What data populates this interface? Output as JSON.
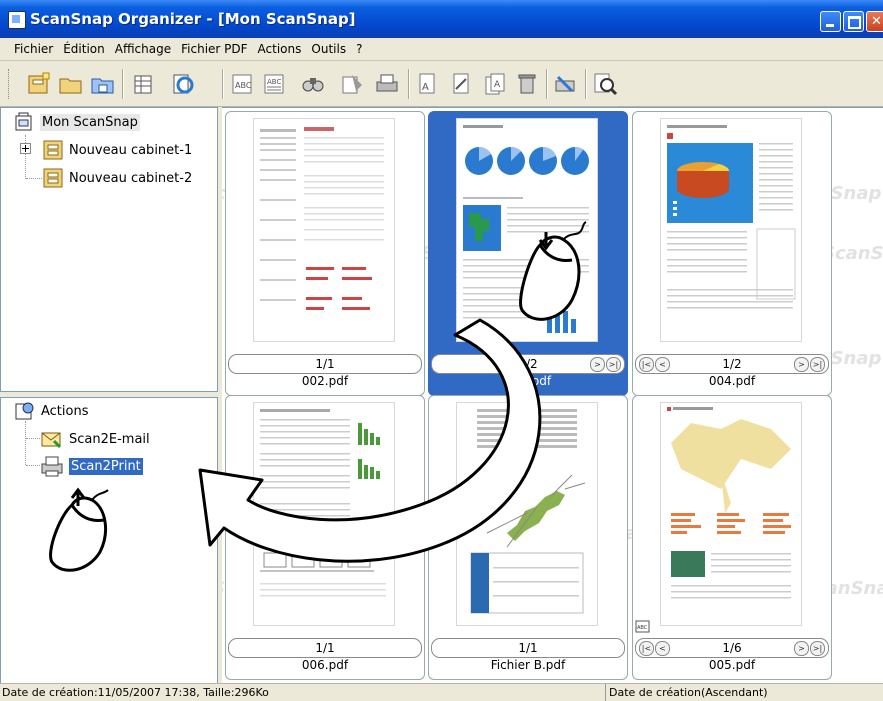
{
  "window": {
    "title": "ScanSnap Organizer - [Mon ScanSnap]"
  },
  "menu": [
    "Fichier",
    "Édition",
    "Affichage",
    "Fichier PDF",
    "Actions",
    "Outils",
    "?"
  ],
  "tree": {
    "root": "Mon ScanSnap",
    "cabinets": [
      "Nouveau cabinet-1",
      "Nouveau cabinet-2"
    ]
  },
  "actions": {
    "header": "Actions",
    "items": [
      {
        "label": "Scan2E-mail",
        "selected": false
      },
      {
        "label": "Scan2Print",
        "selected": true
      }
    ]
  },
  "thumbnails": [
    {
      "file": "002.pdf",
      "page": "1/1",
      "selected": false,
      "nav_left": false,
      "nav_right": false
    },
    {
      "file": "003.pdf",
      "page": "1/2",
      "selected": true,
      "nav_left": false,
      "nav_right": true
    },
    {
      "file": "004.pdf",
      "page": "1/2",
      "selected": false,
      "nav_left": true,
      "nav_right": true
    },
    {
      "file": "006.pdf",
      "page": "1/1",
      "selected": false,
      "nav_left": false,
      "nav_right": false
    },
    {
      "file": "Fichier B.pdf",
      "page": "1/1",
      "selected": false,
      "nav_left": false,
      "nav_right": false
    },
    {
      "file": "005.pdf",
      "page": "1/6",
      "selected": false,
      "nav_left": true,
      "nav_right": true
    }
  ],
  "watermark": "ScanSnap",
  "status": {
    "left": "Date de création:11/05/2007 17:38, Taille:296Ko",
    "right": "Date de création(Ascendant)"
  },
  "colors": {
    "selection": "#316ac5",
    "titlebar": "#0a5fe0"
  }
}
